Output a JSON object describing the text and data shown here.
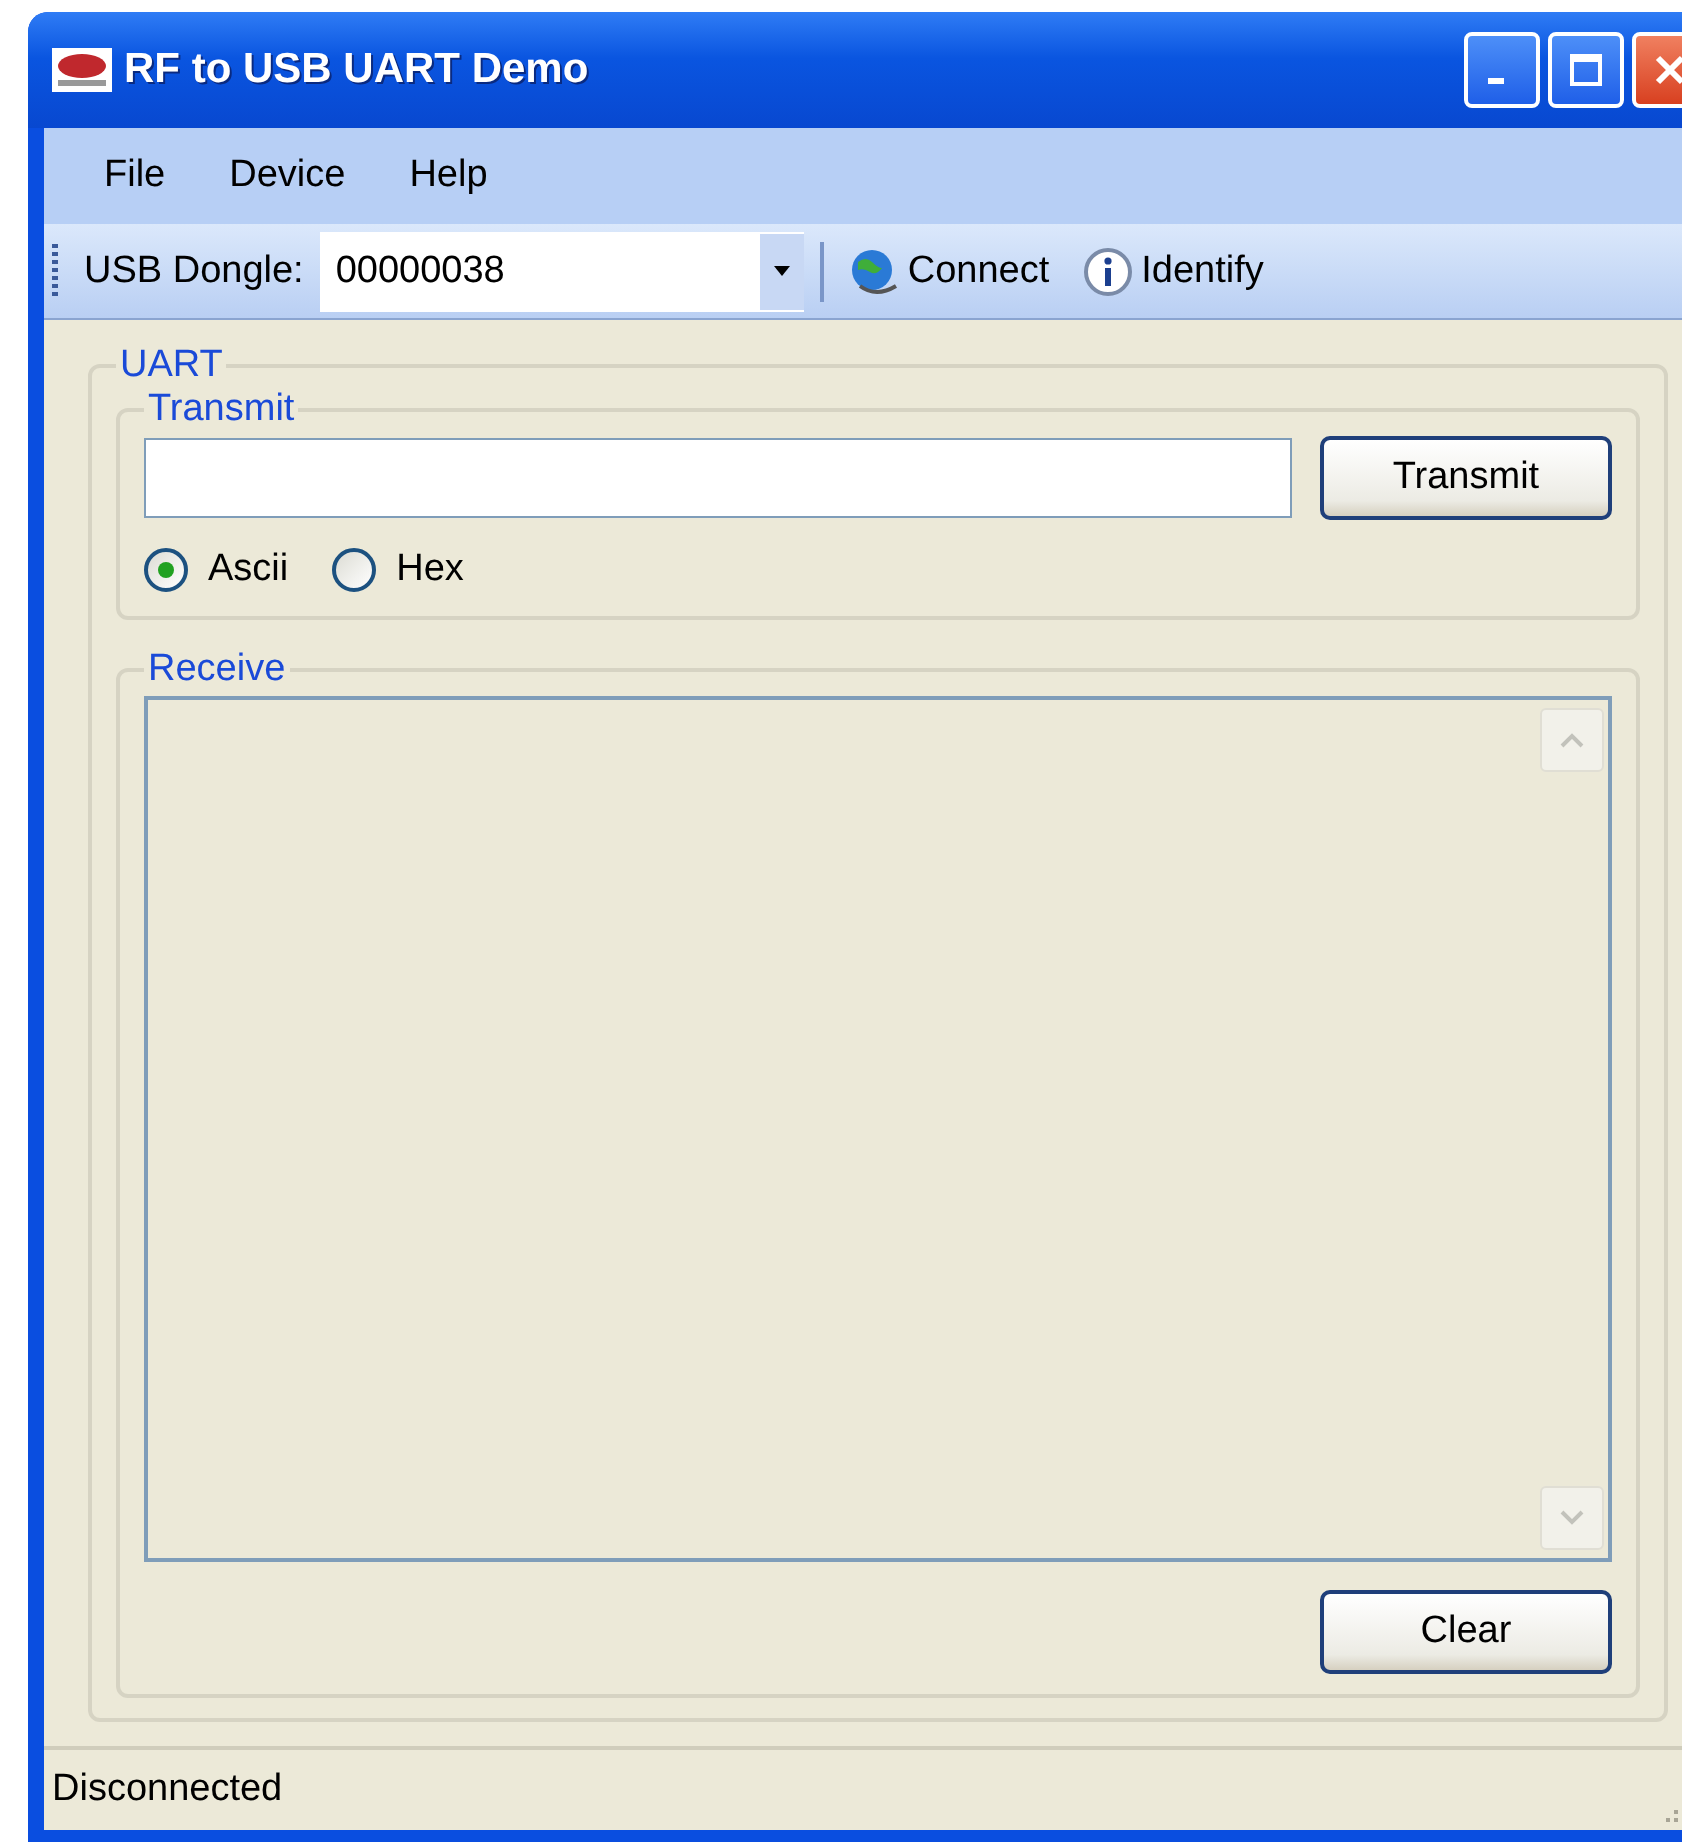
{
  "window": {
    "title": "RF to USB UART Demo"
  },
  "menu": [
    "File",
    "Device",
    "Help"
  ],
  "toolbar": {
    "label": "USB Dongle:",
    "dongle": "00000038",
    "buttons": [
      {
        "kind": "globe",
        "label": "Connect"
      },
      {
        "kind": "info",
        "label": "Identify"
      }
    ]
  },
  "uart": {
    "title": "UART",
    "transmit": {
      "title": "Transmit",
      "button": "Transmit",
      "modes": [
        {
          "label": "Ascii",
          "selected": true
        },
        {
          "label": "Hex",
          "selected": false
        }
      ]
    },
    "receive": {
      "title": "Receive",
      "button": "Clear"
    }
  },
  "status_bar": "Disconnected"
}
